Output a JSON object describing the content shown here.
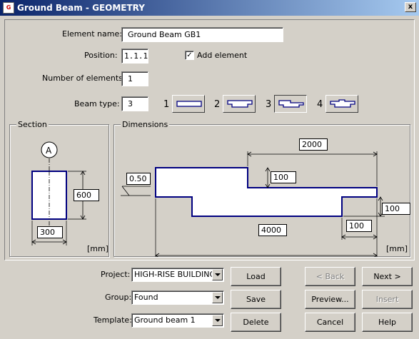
{
  "window": {
    "icon_text": "G",
    "title": "Ground Beam - GEOMETRY",
    "close_glyph": "x"
  },
  "form": {
    "element_name_label": "Element name:",
    "element_name_value": "Ground Beam GB1",
    "position_label": "Position:",
    "position_value": "1.1.1",
    "add_element_label": "Add element",
    "add_element_checked": true,
    "add_element_glyph": "✓",
    "num_elements_label": "Number of elements:",
    "num_elements_value": "1",
    "beam_type_label": "Beam type:",
    "beam_type_value": "3",
    "beam_types": [
      {
        "num": "1",
        "selected": false,
        "shape": "rectangle"
      },
      {
        "num": "2",
        "selected": false,
        "shape": "inverted-t"
      },
      {
        "num": "3",
        "selected": true,
        "shape": "stepped-bottom"
      },
      {
        "num": "4",
        "selected": false,
        "shape": "stepped-top-notch"
      }
    ]
  },
  "section": {
    "label": "Section",
    "axis_label": "A",
    "height": "600",
    "width": "300",
    "unit": "[mm]"
  },
  "dimensions": {
    "label": "Dimensions",
    "slope": "0.50",
    "top_step_length": "2000",
    "top_step_height": "100",
    "right_height": "100",
    "bottom_offset": "100",
    "total_length": "4000",
    "unit": "[mm]"
  },
  "bottom": {
    "project_label": "Project:",
    "project_value": "HIGH-RISE BUILDING",
    "group_label": "Group:",
    "group_value": "Found",
    "template_label": "Template:",
    "template_value": "Ground beam 1"
  },
  "buttons": {
    "load": "Load",
    "save": "Save",
    "delete": "Delete",
    "back": "< Back",
    "next": "Next  >",
    "preview": "Preview...",
    "insert": "Insert",
    "cancel": "Cancel",
    "help": "Help"
  },
  "colors": {
    "beam_outline": "#000080",
    "title_bar": "#0a246a",
    "face": "#d4d0c8"
  }
}
